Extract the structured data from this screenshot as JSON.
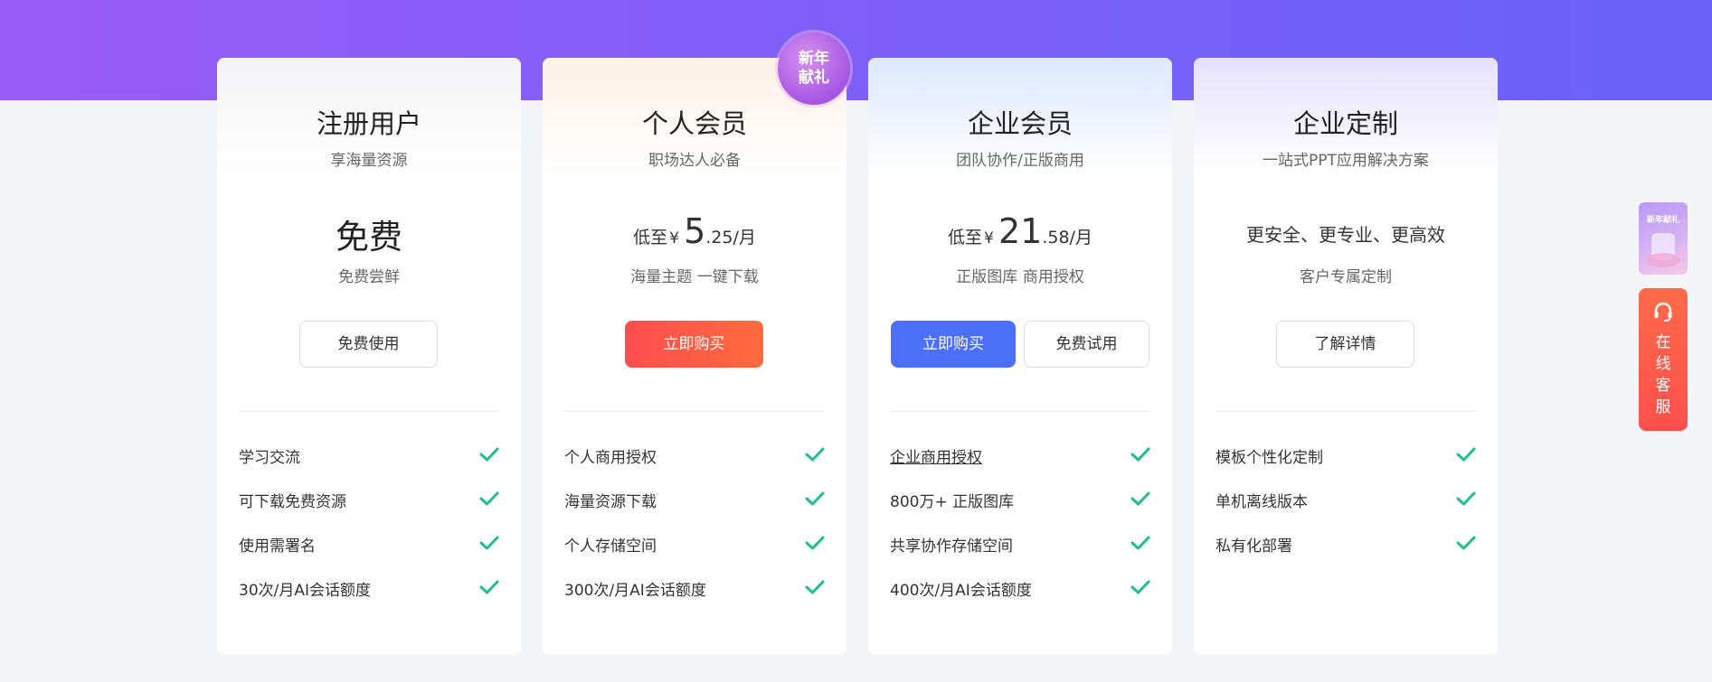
{
  "badge": {
    "line1": "新年",
    "line2": "献礼"
  },
  "plans": [
    {
      "title": "注册用户",
      "subtitle": "享海量资源",
      "price_label": "免费",
      "desc": "免费尝鲜",
      "button": "免费使用",
      "features": [
        "学习交流",
        "可下载免费资源",
        "使用需署名",
        "30次/月AI会话额度"
      ]
    },
    {
      "title": "个人会员",
      "subtitle": "职场达人必备",
      "price_prefix": "低至",
      "currency": "¥",
      "price_int": "5",
      "price_dec": ".25/月",
      "desc": "海量主题 一键下载",
      "button": "立即购买",
      "features": [
        "个人商用授权",
        "海量资源下载",
        "个人存储空间",
        "300次/月AI会话额度"
      ]
    },
    {
      "title": "企业会员",
      "subtitle": "团队协作/正版商用",
      "price_prefix": "低至",
      "currency": "¥",
      "price_int": "21",
      "price_dec": ".58/月",
      "desc": "正版图库 商用授权",
      "button_primary": "立即购买",
      "button_secondary": "免费试用",
      "features": [
        "企业商用授权",
        "800万+ 正版图库",
        "共享协作存储空间",
        "400次/月AI会话额度"
      ]
    },
    {
      "title": "企业定制",
      "subtitle": "一站式PPT应用解决方案",
      "price_label": "更安全、更专业、更高效",
      "desc": "客户专属定制",
      "button": "了解详情",
      "features": [
        "模板个性化定制",
        "单机离线版本",
        "私有化部署"
      ]
    }
  ],
  "side": {
    "promo_text": "新年献礼",
    "service_label": [
      "在",
      "线",
      "客",
      "服"
    ]
  },
  "colors": {
    "banner": "#7b5ff8",
    "check": "#1dbf8f",
    "buy_red": "#fd4d4f",
    "buy_blue": "#4b6ff7",
    "service": "#fe5a4b"
  },
  "icons": {
    "check": "check-icon",
    "headset": "headset-icon"
  }
}
